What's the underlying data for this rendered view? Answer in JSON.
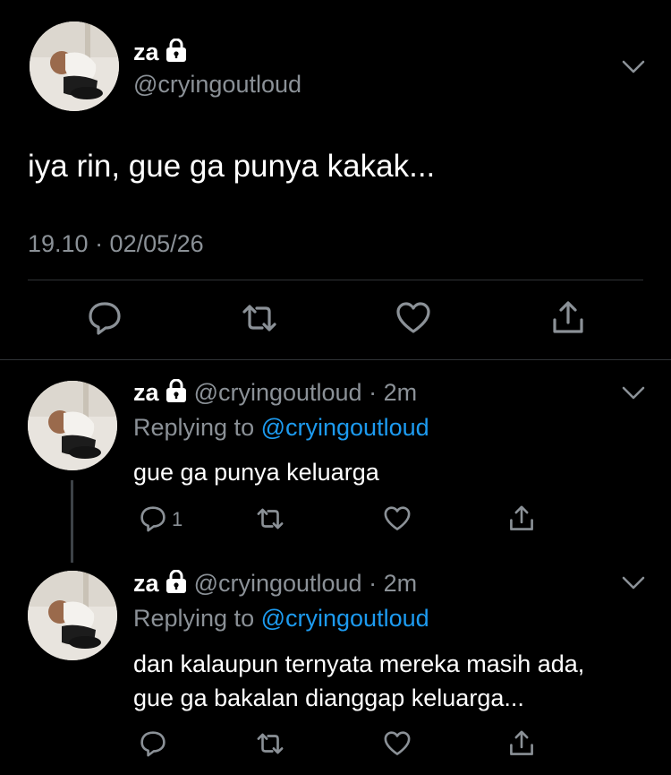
{
  "main_tweet": {
    "name": "za",
    "handle": "@cryingoutloud",
    "text": "iya rin, gue ga punya kakak...",
    "timestamp": "19.10 · 02/05/26"
  },
  "replies": [
    {
      "name": "za",
      "handle": "@cryingoutloud",
      "time": "· 2m",
      "replying_prefix": "Replying to",
      "replying_to": "@cryingoutloud",
      "text_lines": [
        "gue ga punya keluarga"
      ],
      "reply_count": "1"
    },
    {
      "name": "za",
      "handle": "@cryingoutloud",
      "time": "· 2m",
      "replying_prefix": "Replying to",
      "replying_to": "@cryingoutloud",
      "text_lines": [
        "dan kalaupun ternyata mereka masih ada,",
        "gue ga bakalan dianggap keluarga..."
      ],
      "reply_count": ""
    }
  ],
  "colors": {
    "background": "#000000",
    "secondary_text": "#8b9197",
    "link": "#1d9bf0",
    "divider": "#2f3336"
  },
  "icons": [
    "lock-icon",
    "chevron-down-icon",
    "reply-icon",
    "retweet-icon",
    "like-icon",
    "share-icon"
  ]
}
